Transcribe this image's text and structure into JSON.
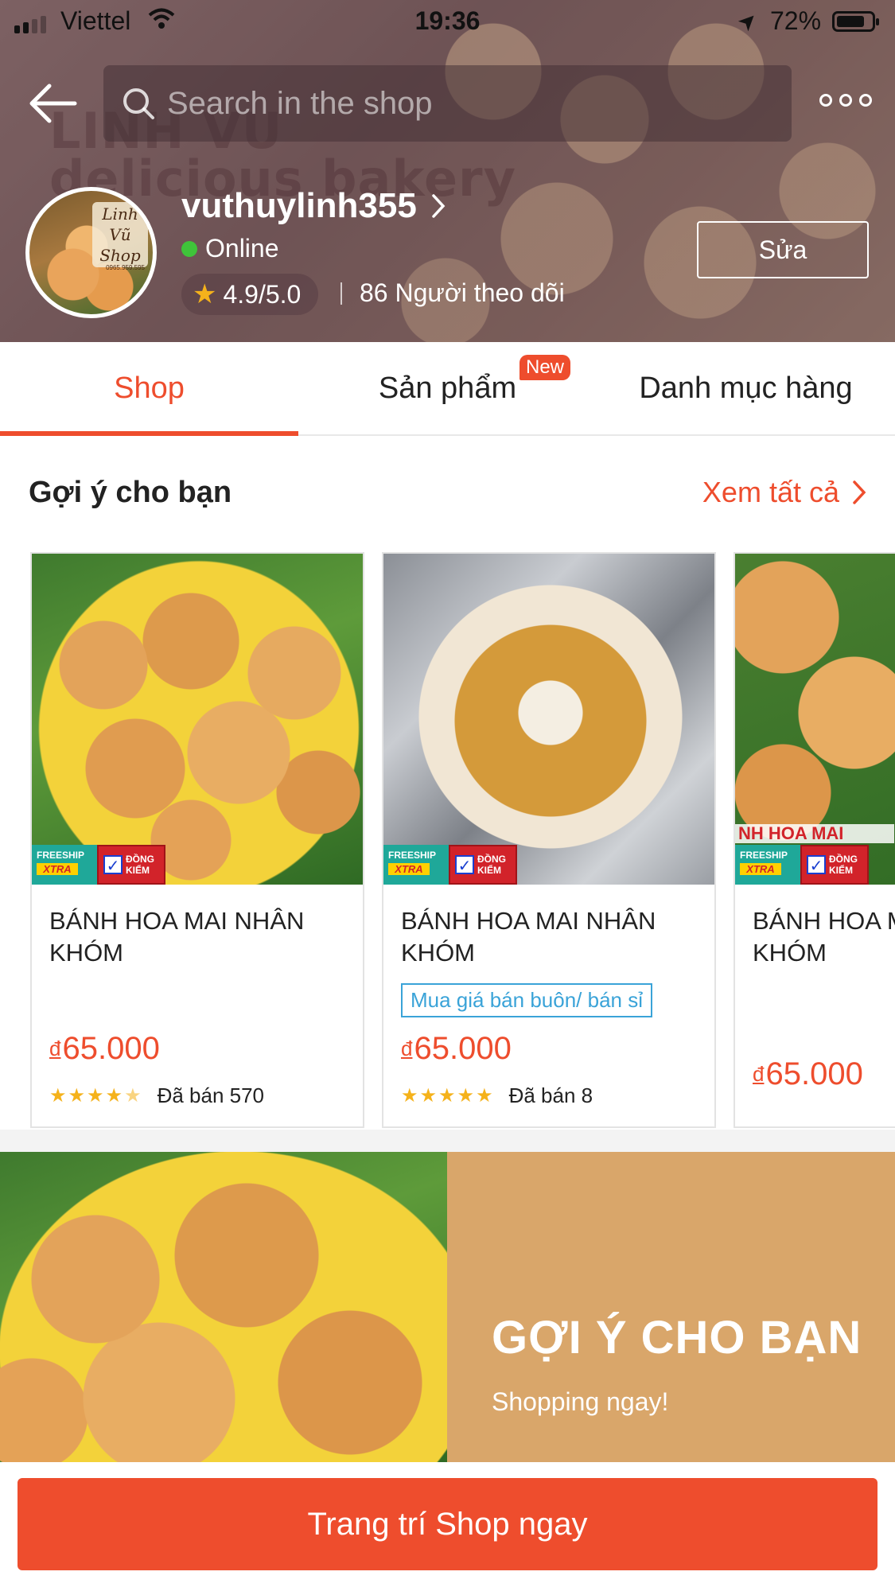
{
  "status_bar": {
    "carrier": "Viettel",
    "time": "19:36",
    "battery": "72%"
  },
  "header": {
    "search_placeholder": "Search in the shop",
    "shop_name": "vuthuylinh355",
    "online_status": "Online",
    "rating": "4.9/5.0",
    "followers": "86 Người theo dõi",
    "edit_label": "Sửa",
    "bg_text": [
      "LINH VU",
      "delicious bakery"
    ],
    "avatar_logo_text": [
      "Linh Vũ",
      "Shop"
    ],
    "avatar_phone": "0965.959.595"
  },
  "tabs": [
    {
      "label": "Shop",
      "active": true
    },
    {
      "label": "Sản phẩm",
      "badge": "New"
    },
    {
      "label": "Danh mục hàng"
    }
  ],
  "suggestions": {
    "title": "Gợi ý cho bạn",
    "see_all": "Xem tất cả",
    "products": [
      {
        "name": "BÁNH HOA MAI NHÂN KHÓM",
        "currency": "đ",
        "price": "65.000",
        "rating": 4.5,
        "sold": "Đã bán 570",
        "tags": [
          "FREESHIP XTRA",
          "ĐỒNG KIỂM"
        ]
      },
      {
        "name": "BÁNH HOA MAI NHÂN KHÓM",
        "currency": "đ",
        "price": "65.000",
        "rating": 5,
        "sold": "Đã bán 8",
        "wholesale": "Mua giá bán buôn/ bán sỉ",
        "tags": [
          "FREESHIP XTRA",
          "ĐỒNG KIỂM"
        ]
      },
      {
        "name": "BÁNH HOA MAI NHÂN KHÓM",
        "currency": "đ",
        "price": "65.000",
        "image_text": "NH HOA MAI",
        "tags": [
          "FREESHIP XTRA",
          "ĐỒNG KIỂM"
        ]
      }
    ]
  },
  "banner": {
    "title": "GỢI Ý CHO BẠN",
    "subtitle": "Shopping ngay!"
  },
  "cta": {
    "label": "Trang trí Shop ngay"
  },
  "tag_text": {
    "freeship": "FREESHIP",
    "xtra": "XTRA",
    "dong": "ĐỒNG",
    "kiem": "KIỂM"
  },
  "colors": {
    "accent": "#ee4d2d",
    "online": "#3fc43a",
    "star": "#f5b21b",
    "wholesale": "#3aa3d8",
    "banner_bg": "#d9a66a"
  }
}
